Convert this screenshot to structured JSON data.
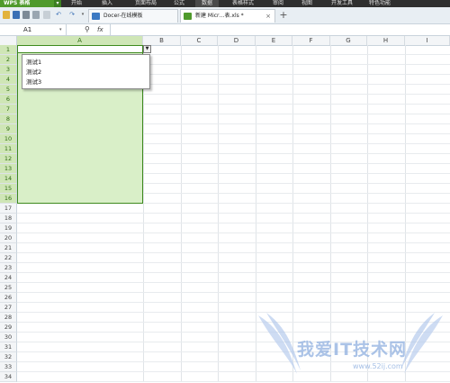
{
  "app": {
    "brand": "WPS 表格",
    "menu": [
      "开始",
      "插入",
      "页面布局",
      "公式",
      "数据",
      "表格样式",
      "审阅",
      "视图",
      "开发工具",
      "特色功能"
    ],
    "active_menu": "数据"
  },
  "tabs": [
    {
      "label": "Docer-在线模板"
    },
    {
      "label": "新建 Micr…表.xls *"
    }
  ],
  "namebox": {
    "value": "A1"
  },
  "formula": {
    "fx_label": "fx",
    "value": ""
  },
  "columns": [
    "A",
    "B",
    "C",
    "D",
    "E",
    "F",
    "G",
    "H",
    "I"
  ],
  "rows": [
    "1",
    "2",
    "3",
    "4",
    "5",
    "6",
    "7",
    "8",
    "9",
    "10",
    "11",
    "12",
    "13",
    "14",
    "15",
    "16",
    "17",
    "18",
    "19",
    "20",
    "21",
    "22",
    "23",
    "24",
    "25",
    "26",
    "27",
    "28",
    "29",
    "30",
    "31",
    "32",
    "33",
    "34"
  ],
  "dropdown": {
    "items": [
      "测试1",
      "测试2",
      "测试3"
    ]
  },
  "watermark": {
    "text": "我爱IT技术网",
    "url": "www.52ij.com"
  },
  "colors": {
    "accent": "#4f9a2c",
    "selection": "#d9efc8",
    "selection_border": "#3e8a1e"
  }
}
